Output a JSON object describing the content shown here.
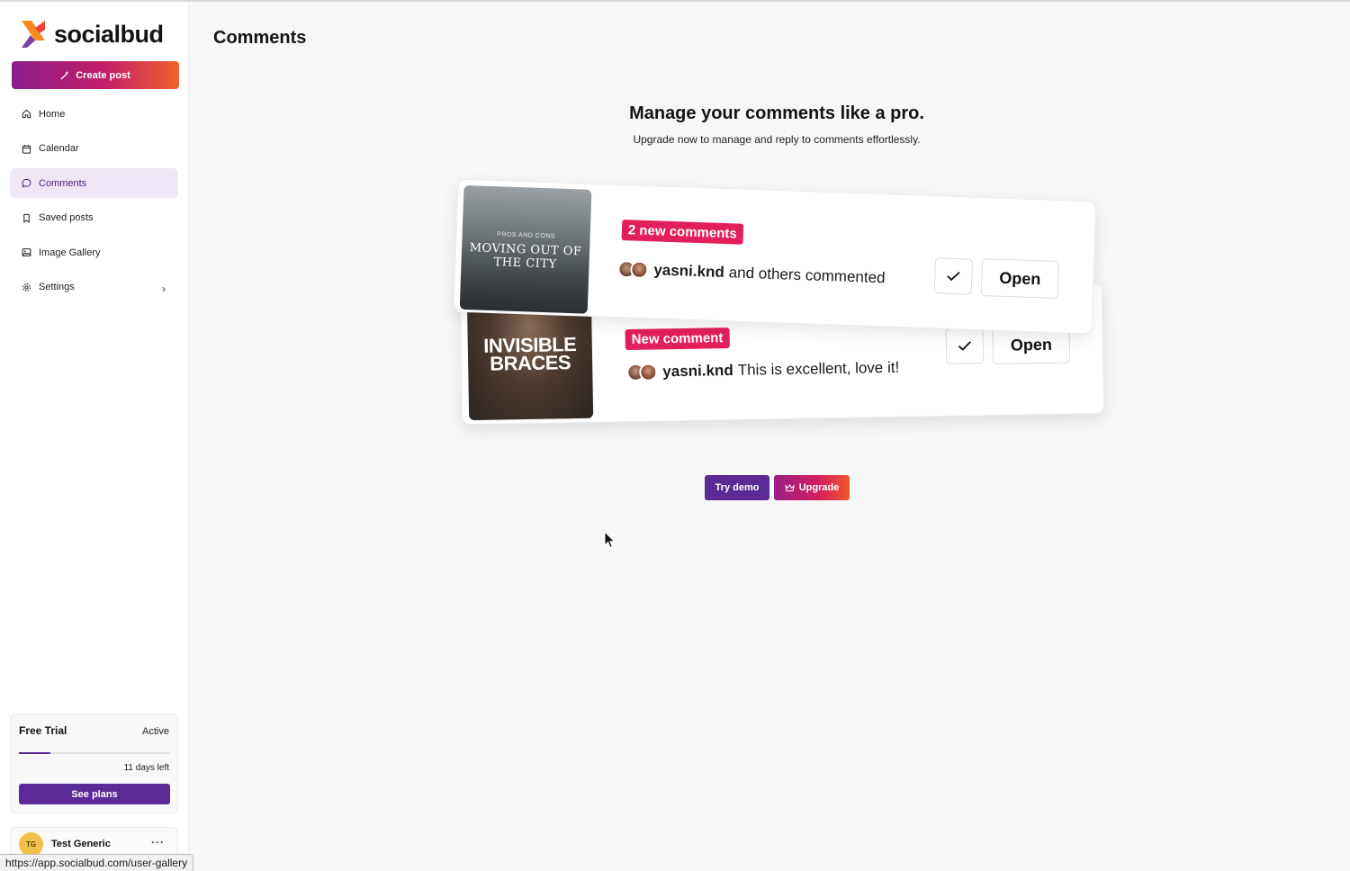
{
  "app": {
    "name": "socialbud"
  },
  "sidebar": {
    "create_label": "Create post",
    "items": [
      {
        "label": "Home",
        "icon": "home-icon",
        "active": false
      },
      {
        "label": "Calendar",
        "icon": "calendar-icon",
        "active": false
      },
      {
        "label": "Comments",
        "icon": "comment-icon",
        "active": true
      },
      {
        "label": "Saved posts",
        "icon": "bookmark-icon",
        "active": false
      },
      {
        "label": "Image Gallery",
        "icon": "image-icon",
        "active": false
      },
      {
        "label": "Settings",
        "icon": "gear-icon",
        "active": false
      }
    ],
    "trial": {
      "title": "Free Trial",
      "status": "Active",
      "progress": 0.21,
      "days_left": "11 days left",
      "plans_label": "See plans"
    },
    "user": {
      "initials": "TG",
      "name": "Test Generic",
      "more": "···"
    }
  },
  "main": {
    "title": "Comments",
    "hero_title": "Manage your comments like a pro.",
    "hero_subtitle": "Upgrade now to manage and reply to comments effortlessly.",
    "cards": {
      "front": {
        "thumb_small": "PROS AND CONS",
        "thumb_big": "MOVING OUT OF THE CITY",
        "badge": "2 new comments",
        "user": "yasni.knd",
        "text": "and others commented",
        "open_label": "Open"
      },
      "back": {
        "thumb_text": "INVISIBLE BRACES",
        "badge": "New comment",
        "user": "yasni.knd",
        "text": "This is excellent, love it!",
        "open_label": "Open"
      }
    },
    "try_demo_label": "Try demo",
    "upgrade_label": "Upgrade"
  },
  "statusbar": {
    "url": "https://app.socialbud.com/user-gallery"
  },
  "colors": {
    "accent": "#5b2a96",
    "active_bg": "#efe6f6",
    "badge": "#e21e5b",
    "gradient_start": "#8b1f8a",
    "gradient_end": "#f0612b"
  }
}
